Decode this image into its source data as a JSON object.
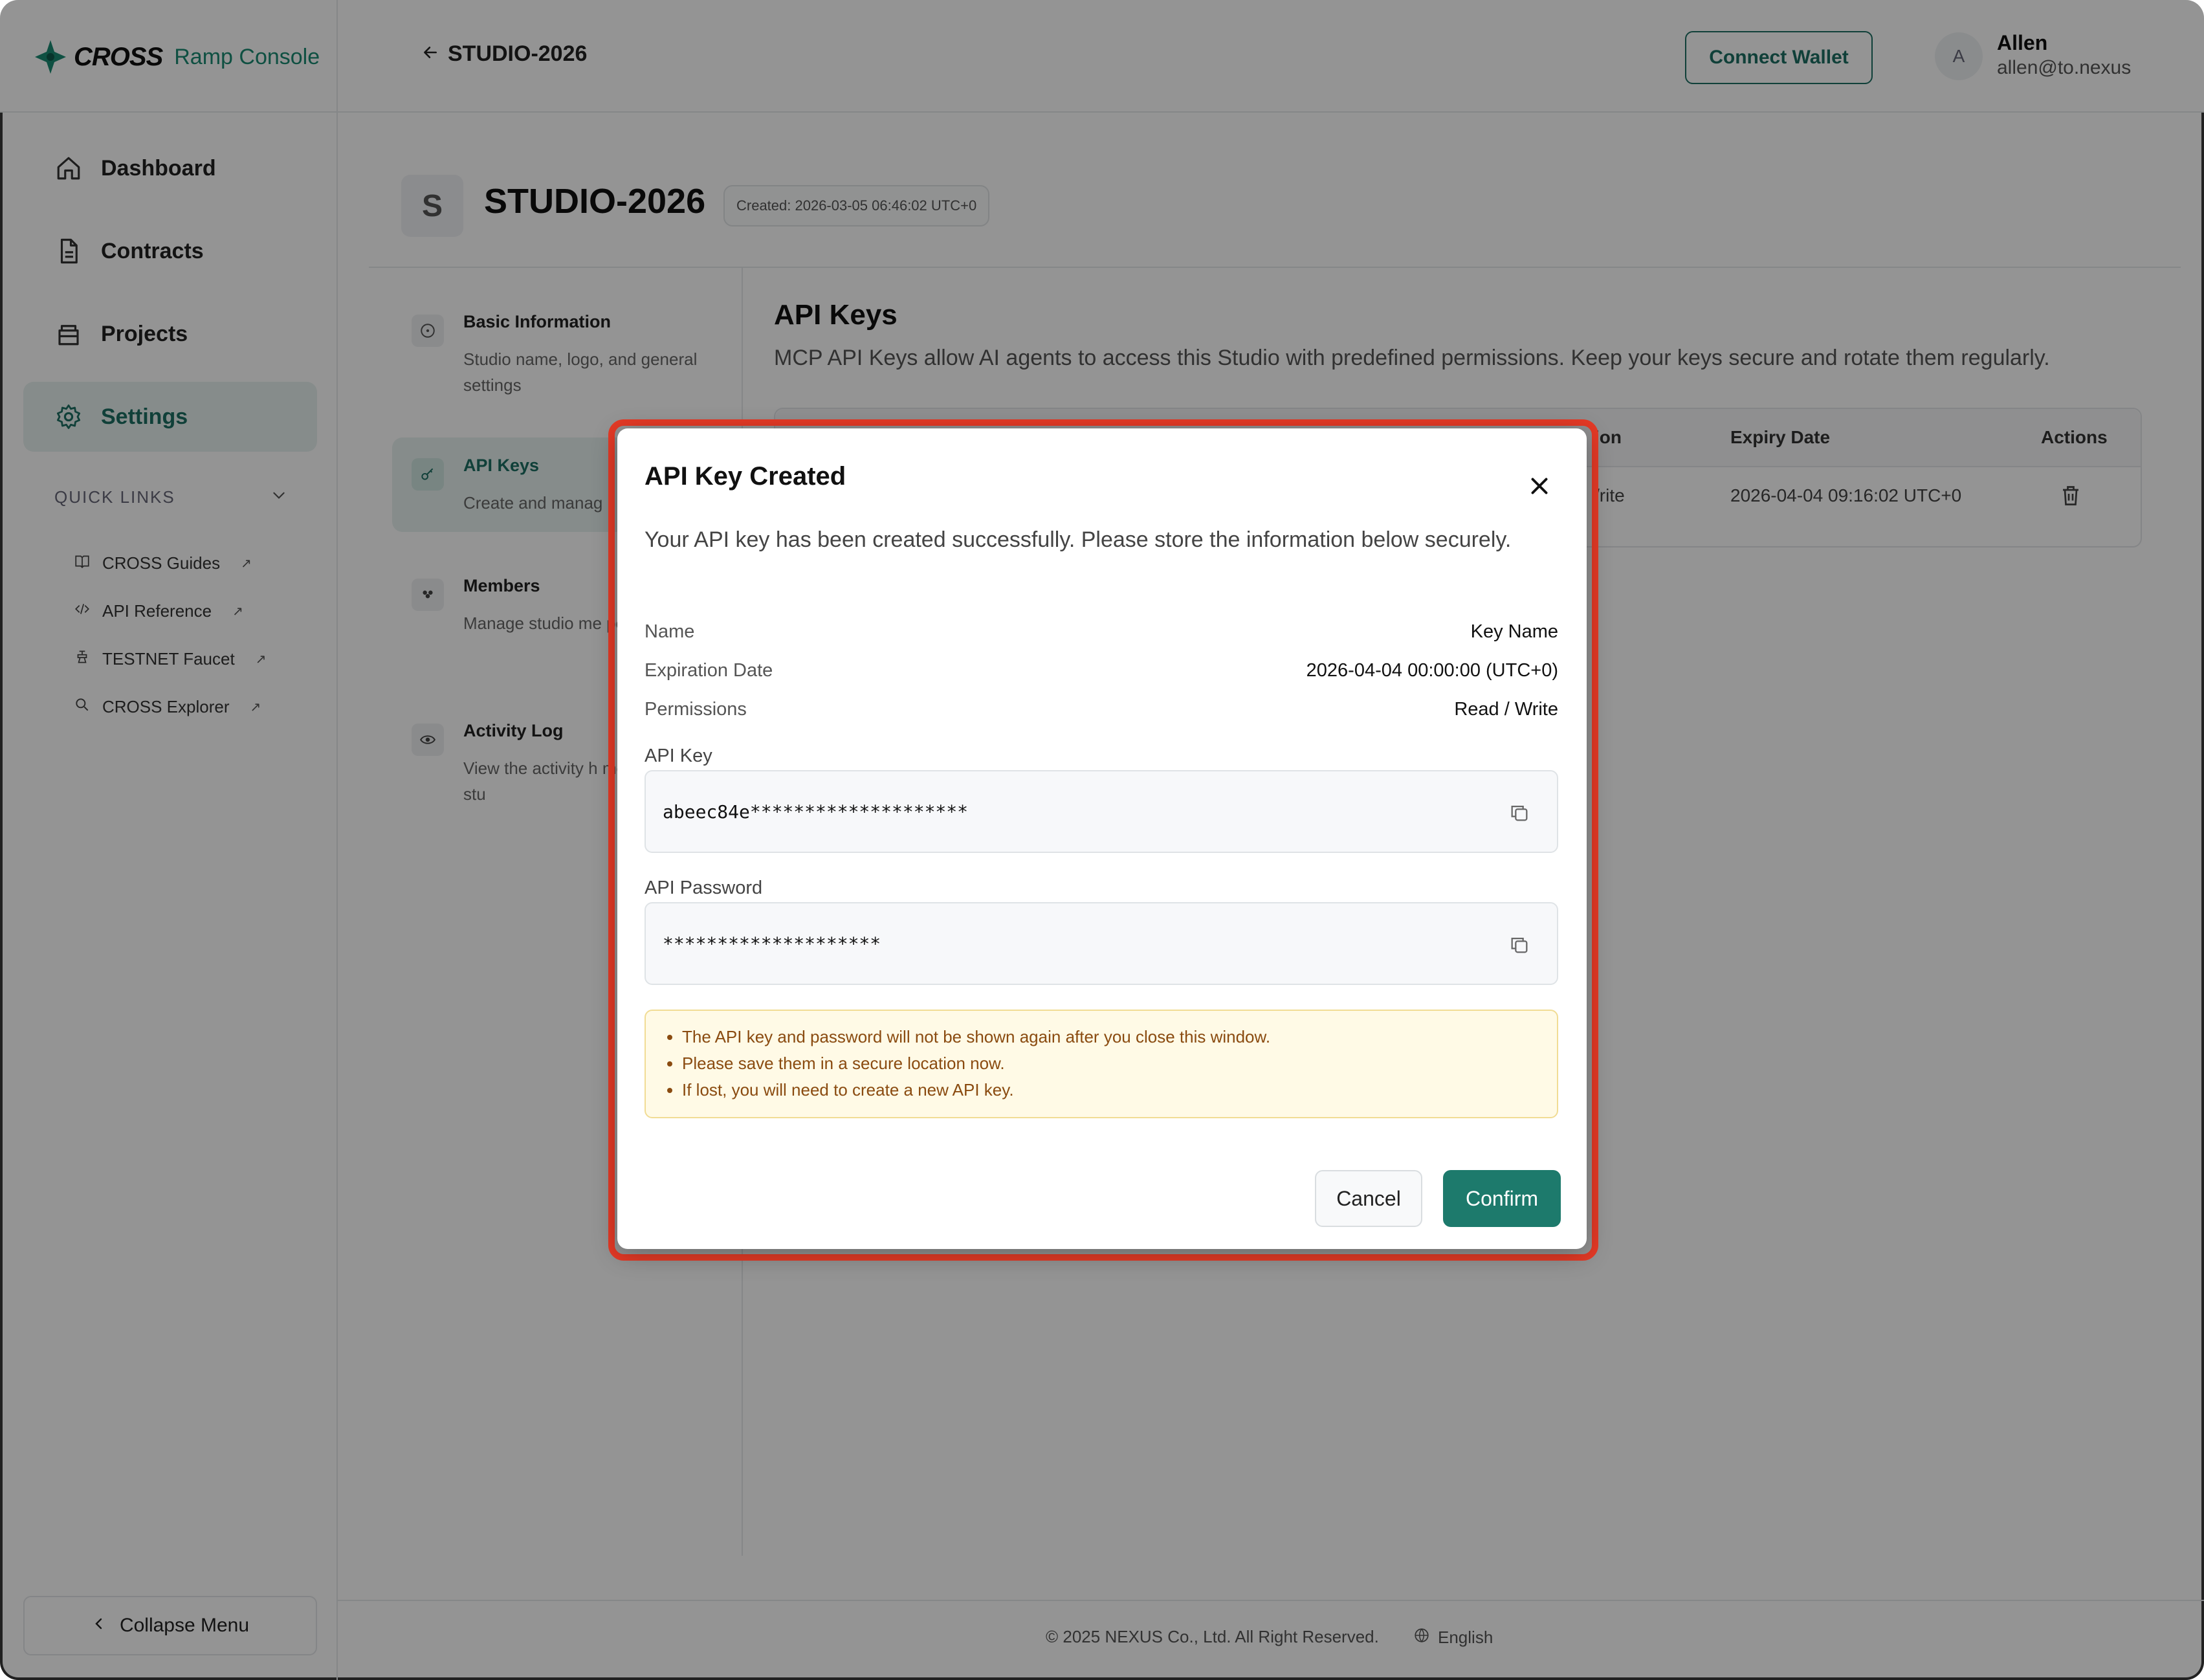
{
  "app": {
    "logo_text": "CROSS",
    "logo_sub": "Ramp Console",
    "back_label": "STUDIO-2026",
    "connect_wallet": "Connect Wallet",
    "user_initial": "A",
    "user_name": "Allen",
    "user_email": "allen@to.nexus"
  },
  "sidebar": {
    "items": [
      {
        "label": "Dashboard",
        "icon": "home-icon"
      },
      {
        "label": "Contracts",
        "icon": "document-icon"
      },
      {
        "label": "Projects",
        "icon": "box-icon"
      },
      {
        "label": "Settings",
        "icon": "gear-icon",
        "active": true
      }
    ],
    "quick_links_title": "QUICK LINKS",
    "quick_links": [
      {
        "label": "CROSS Guides",
        "icon": "book-icon"
      },
      {
        "label": "API Reference",
        "icon": "code-icon"
      },
      {
        "label": "TESTNET Faucet",
        "icon": "faucet-icon"
      },
      {
        "label": "CROSS Explorer",
        "icon": "search-icon"
      }
    ],
    "collapse_label": "Collapse Menu"
  },
  "studio": {
    "initial": "S",
    "title": "STUDIO-2026",
    "created": "Created: 2026-03-05 06:46:02 UTC+0"
  },
  "settings_nav": [
    {
      "title": "Basic Information",
      "desc": "Studio name, logo, and general settings"
    },
    {
      "title": "API Keys",
      "desc": "Create and manag",
      "active": true
    },
    {
      "title": "Members",
      "desc": "Manage studio me permissions"
    },
    {
      "title": "Activity Log",
      "desc": "View the activity h members in the stu"
    }
  ],
  "api_keys": {
    "title": "API Keys",
    "desc": "MCP API Keys allow AI agents to access this Studio with predefined permissions. Keep your keys secure and rotate them regularly.",
    "col_permission_partial": "ion",
    "col_expiry": "Expiry Date",
    "col_actions": "Actions",
    "row_permission_partial": "/rite",
    "row_expiry": "2026-04-04 09:16:02 UTC+0"
  },
  "footer": {
    "copyright": "© 2025 NEXUS Co., Ltd. All Right Reserved.",
    "language": "English"
  },
  "modal": {
    "title": "API Key Created",
    "intro": "Your API key has been created successfully. Please store the information below securely.",
    "name_label": "Name",
    "name_value": "Key Name",
    "expiration_label": "Expiration Date",
    "expiration_value": "2026-04-04 00:00:00 (UTC+0)",
    "permissions_label": "Permissions",
    "permissions_value": "Read / Write",
    "api_key_label": "API Key",
    "api_key_value": "abeec84e********************",
    "api_password_label": "API Password",
    "api_password_value": "********************",
    "warnings": [
      "The API key and password will not be shown again after you close this window.",
      "Please save them in a secure location now.",
      "If lost, you will need to create a new API key."
    ],
    "cancel": "Cancel",
    "confirm": "Confirm"
  },
  "colors": {
    "accent": "#1d7a6c",
    "highlight": "#e53a26",
    "warning_bg": "#fffae6",
    "warning_text": "#8a4b10"
  }
}
